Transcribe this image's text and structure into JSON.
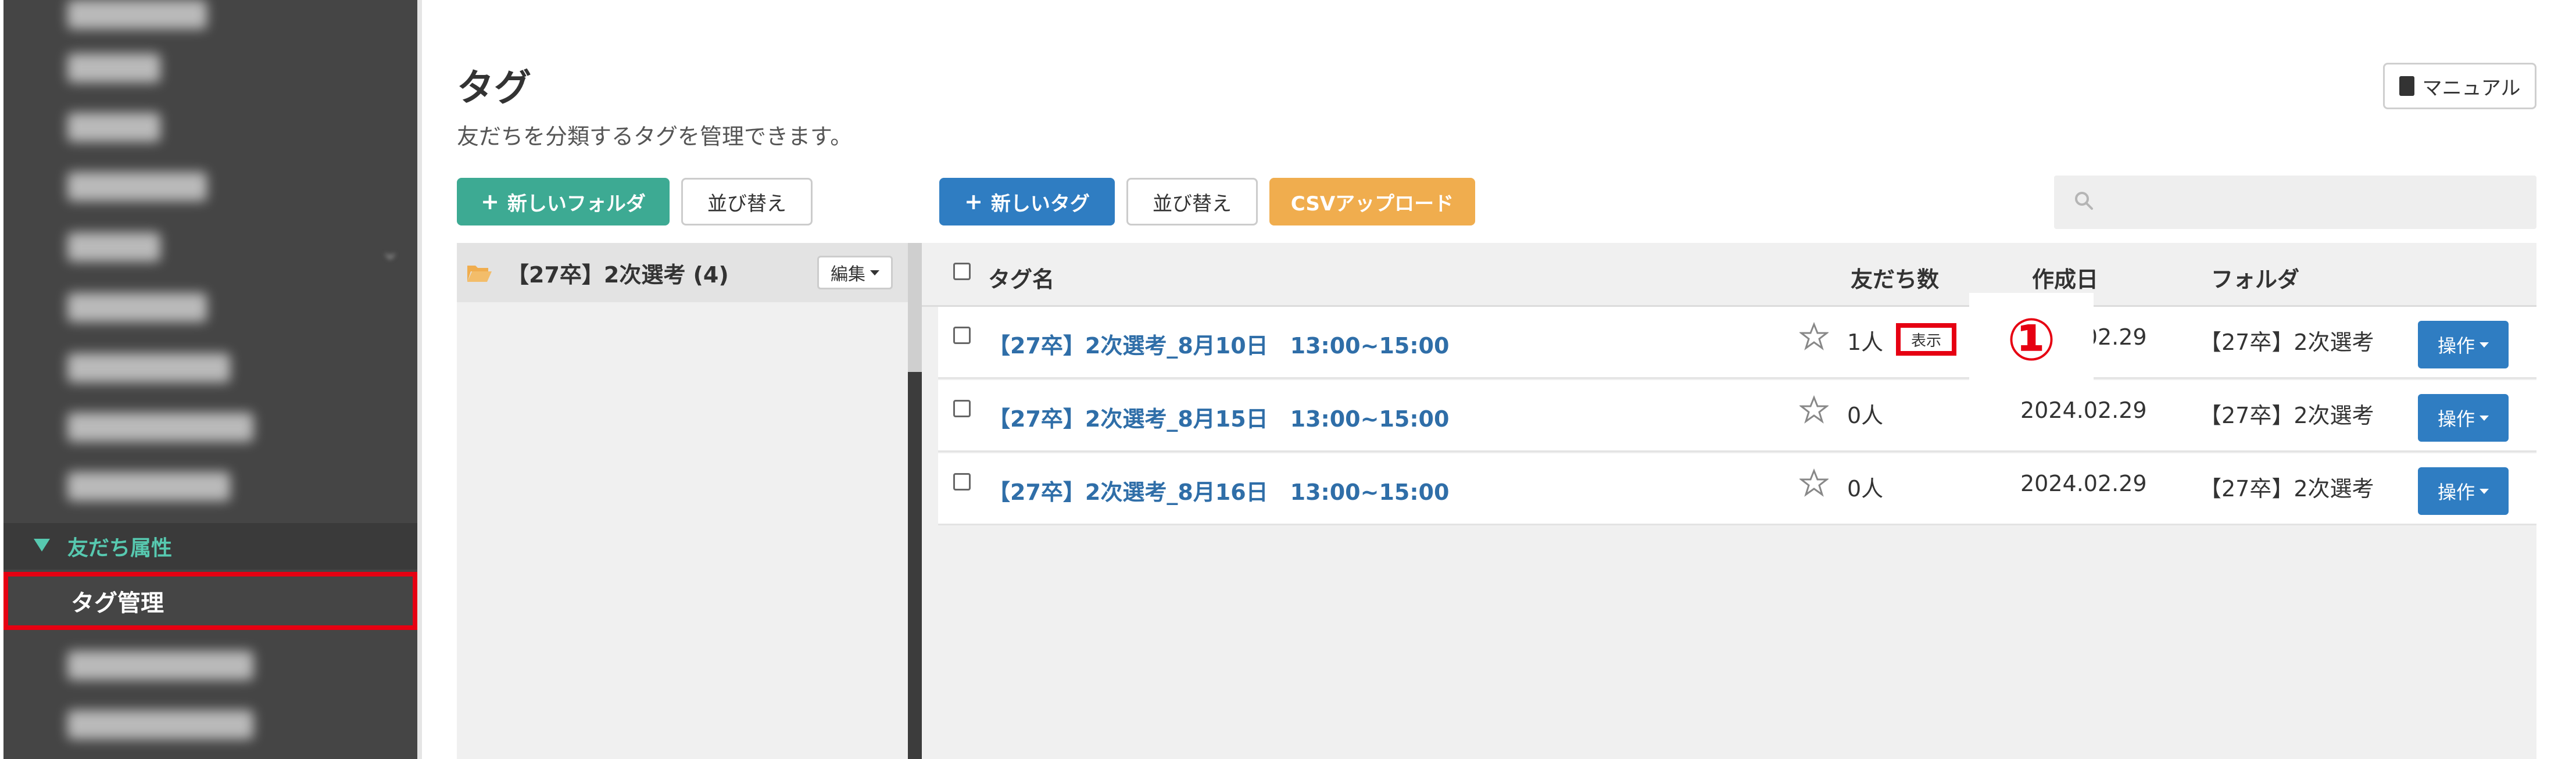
{
  "sidebar": {
    "category_label": "友だち属性",
    "active_item": "タグ管理"
  },
  "header": {
    "title": "タグ",
    "description": "友だちを分類するタグを管理できます。",
    "manual_label": "マニュアル"
  },
  "toolbar": {
    "new_folder": "新しいフォルダ",
    "sort_folders": "並び替え",
    "new_tag": "新しいタグ",
    "sort_tags": "並び替え",
    "csv_upload": "CSVアップロード",
    "search_placeholder": ""
  },
  "folders": [
    {
      "name": "【27卒】2次選考 (4)",
      "edit_label": "編集"
    }
  ],
  "table": {
    "headers": {
      "tag_name": "タグ名",
      "friend_count": "友だち数",
      "created": "作成日",
      "folder": "フォルダ"
    },
    "show_label": "表示",
    "operate_label": "操作",
    "rows": [
      {
        "name": "【27卒】2次選考_8月10日　13:00~15:00",
        "count": "1人",
        "date": "2024.02.29",
        "folder": "【27卒】2次選考"
      },
      {
        "name": "【27卒】2次選考_8月15日　13:00~15:00",
        "count": "0人",
        "date": "2024.02.29",
        "folder": "【27卒】2次選考"
      },
      {
        "name": "【27卒】2次選考_8月16日　13:00~15:00",
        "count": "0人",
        "date": "2024.02.29",
        "folder": "【27卒】2次選考"
      }
    ]
  },
  "annotation": {
    "marker": "①"
  },
  "colors": {
    "accent_red": "#e60012",
    "primary_blue": "#2f7dc2",
    "green": "#3daa93",
    "orange": "#f0ad4e",
    "link": "#2f6ea8"
  }
}
